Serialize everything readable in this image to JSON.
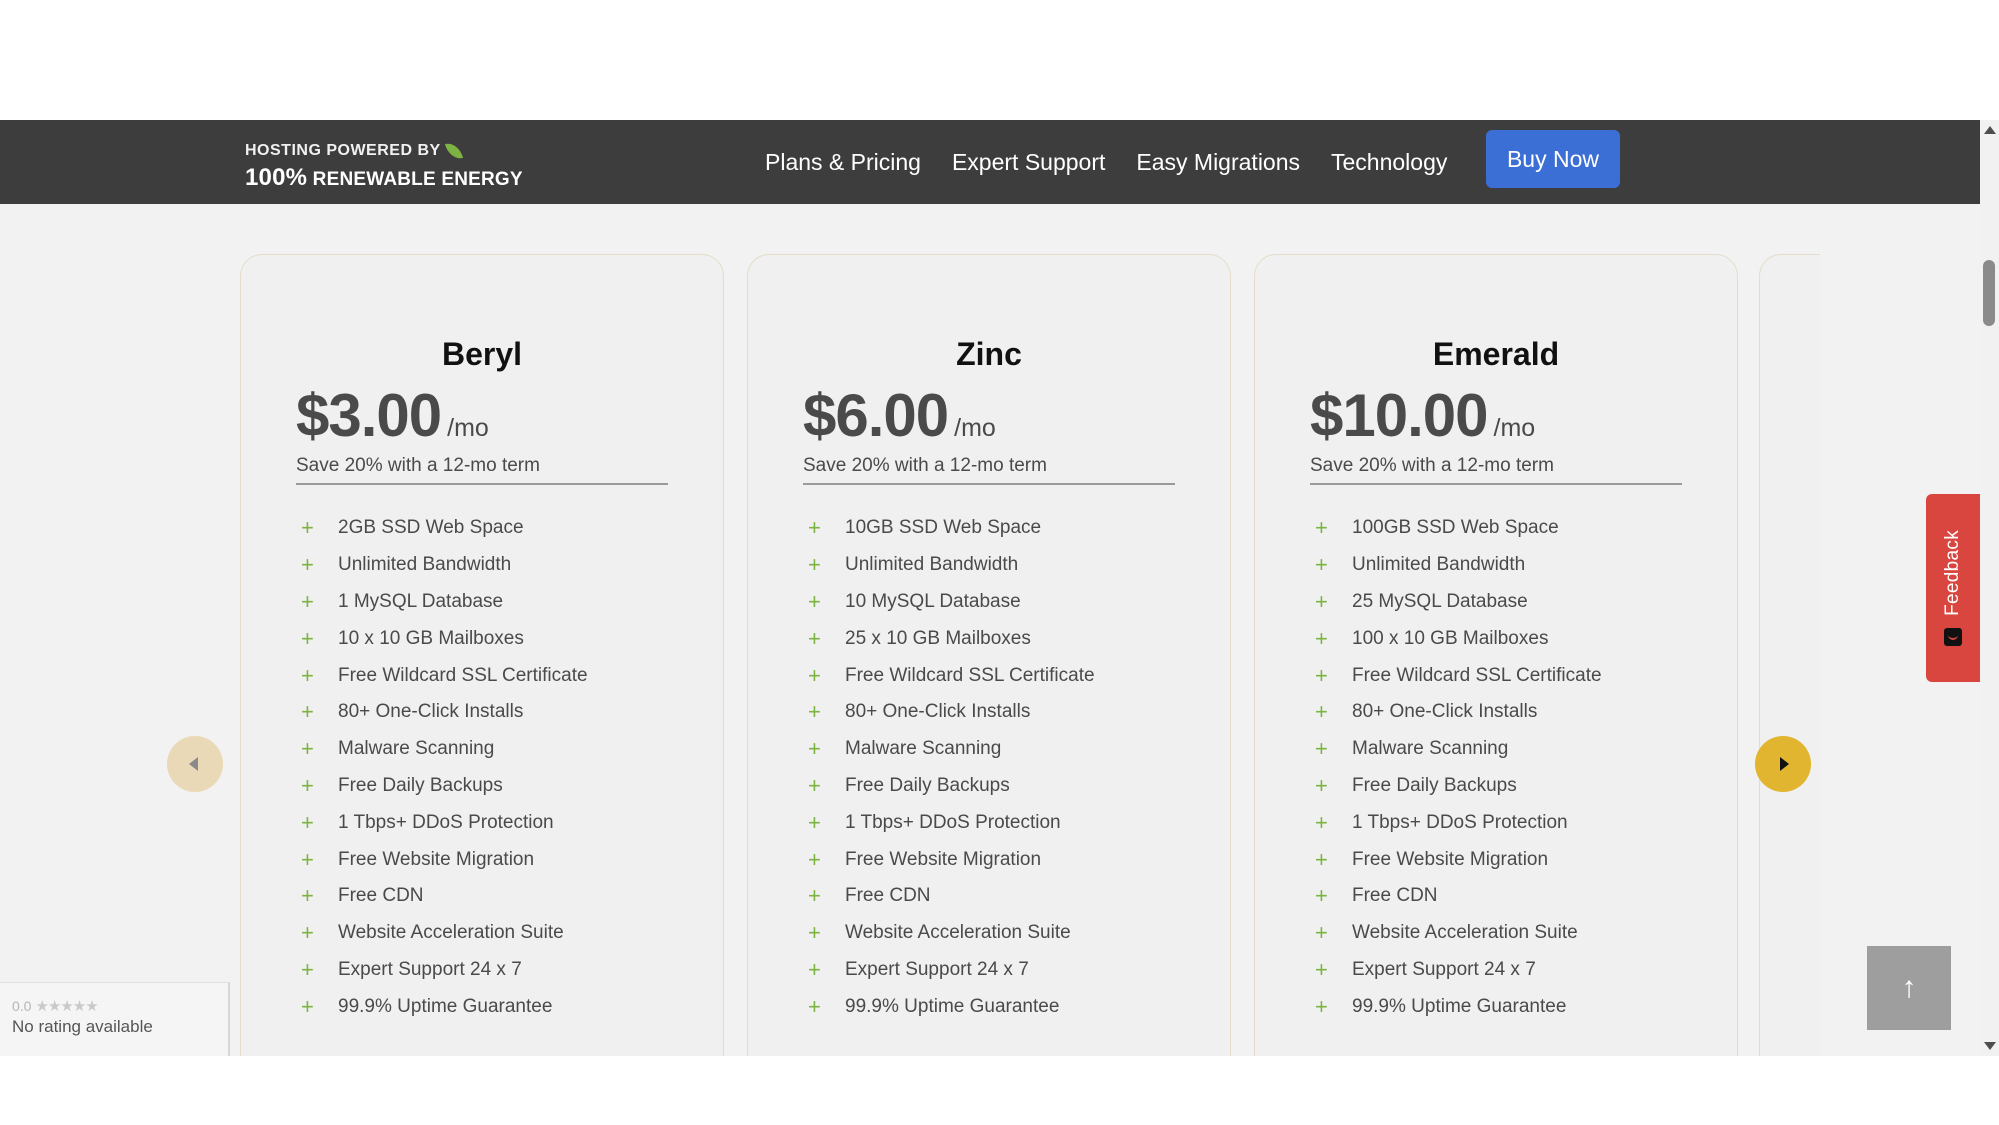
{
  "header": {
    "logo": {
      "line1": "HOSTING POWERED BY",
      "line2_big": "100%",
      "line2_rest": "RENEWABLE ENERGY"
    },
    "nav": [
      "Plans & Pricing",
      "Expert Support",
      "Easy Migrations",
      "Technology"
    ],
    "buy_label": "Buy Now"
  },
  "plans": [
    {
      "name": "Beryl",
      "price": "$3.00",
      "period": "/mo",
      "save": "Save 20% with a 12-mo term",
      "features": [
        "2GB SSD Web Space",
        "Unlimited Bandwidth",
        "1 MySQL Database",
        "10 x 10 GB Mailboxes",
        "Free Wildcard SSL Certificate",
        "80+ One-Click Installs",
        "Malware Scanning",
        "Free Daily Backups",
        "1 Tbps+ DDoS Protection",
        "Free Website Migration",
        "Free CDN",
        "Website Acceleration Suite",
        "Expert Support 24 x 7",
        "99.9% Uptime Guarantee"
      ]
    },
    {
      "name": "Zinc",
      "price": "$6.00",
      "period": "/mo",
      "save": "Save 20% with a 12-mo term",
      "features": [
        "10GB SSD Web Space",
        "Unlimited Bandwidth",
        "10 MySQL Database",
        "25 x 10 GB Mailboxes",
        "Free Wildcard SSL Certificate",
        "80+ One-Click Installs",
        "Malware Scanning",
        "Free Daily Backups",
        "1 Tbps+ DDoS Protection",
        "Free Website Migration",
        "Free CDN",
        "Website Acceleration Suite",
        "Expert Support 24 x 7",
        "99.9% Uptime Guarantee"
      ]
    },
    {
      "name": "Emerald",
      "price": "$10.00",
      "period": "/mo",
      "save": "Save 20% with a 12-mo term",
      "features": [
        "100GB SSD Web Space",
        "Unlimited Bandwidth",
        "25 MySQL Database",
        "100 x 10 GB Mailboxes",
        "Free Wildcard SSL Certificate",
        "80+ One-Click Installs",
        "Malware Scanning",
        "Free Daily Backups",
        "1 Tbps+ DDoS Protection",
        "Free Website Migration",
        "Free CDN",
        "Website Acceleration Suite",
        "Expert Support 24 x 7",
        "99.9% Uptime Guarantee"
      ]
    }
  ],
  "feedback_label": "Feedback",
  "back_to_top_glyph": "↑",
  "rating": {
    "score": "0.0",
    "stars": "★★★★★",
    "text": "No rating available"
  },
  "icons": {
    "feature": "plus-icon",
    "leaf": "leaf-icon",
    "prev": "chevron-left-icon",
    "next": "chevron-right-icon"
  },
  "colors": {
    "nav_bg": "#3d3d3d",
    "buy_button": "#3b6fd6",
    "next_arrow": "#e1b52f",
    "prev_arrow": "#ead9b6",
    "feedback": "#d9463f",
    "plus": "#7cb342"
  }
}
